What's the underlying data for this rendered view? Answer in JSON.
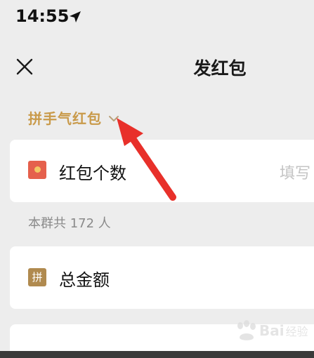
{
  "status_bar": {
    "time": "14:55",
    "location_icon": "location-arrow-icon"
  },
  "nav": {
    "close_icon": "close-icon",
    "title": "发红包"
  },
  "packet_type": {
    "label": "拼手气红包",
    "chevron_icon": "chevron-down-icon"
  },
  "count_row": {
    "icon": "red-packet-icon",
    "label": "红包个数",
    "placeholder": "填写"
  },
  "group_info": "本群共 172 人",
  "amount_row": {
    "icon_text": "拼",
    "label": "总金额"
  },
  "annotation": {
    "arrow_color": "#e8302a"
  },
  "watermark": {
    "text": "Bai",
    "suffix": "经验"
  },
  "colors": {
    "accent_gold": "#c99a4a",
    "packet_red": "#e5604c",
    "pin_gold": "#b08a4f",
    "background": "#ededed"
  }
}
